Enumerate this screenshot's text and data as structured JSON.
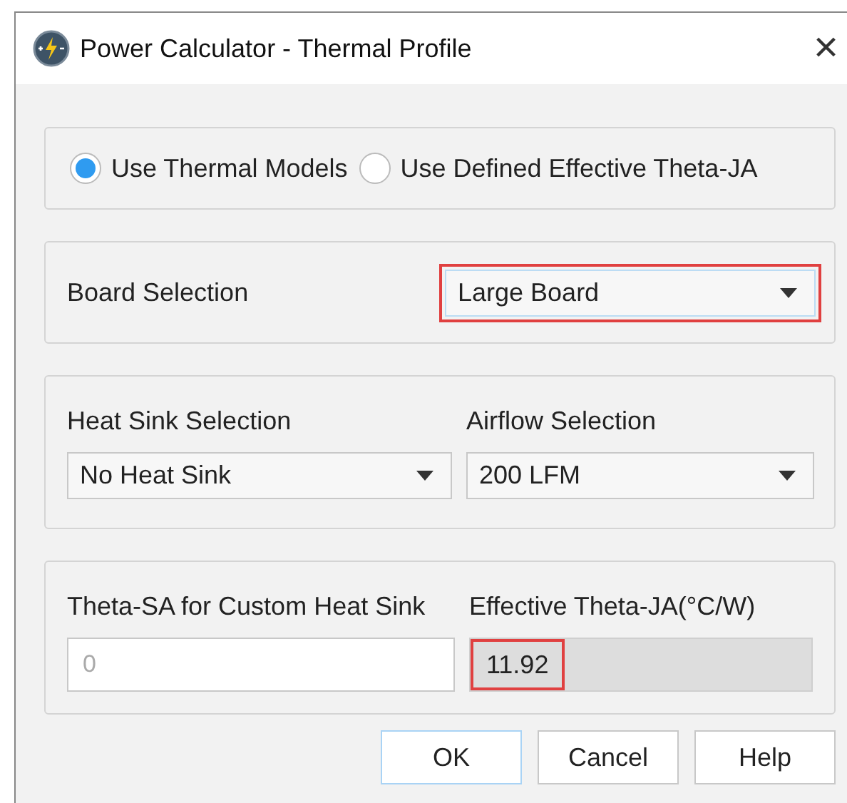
{
  "window": {
    "title": "Power Calculator - Thermal Profile",
    "close": "×"
  },
  "mode_options": [
    {
      "label": "Use Thermal Models",
      "selected": true
    },
    {
      "label": "Use Defined Effective Theta-JA",
      "selected": false
    }
  ],
  "board": {
    "label": "Board Selection",
    "value": "Large Board",
    "highlighted": true
  },
  "heat_sink": {
    "label": "Heat Sink Selection",
    "value": "No Heat Sink",
    "highlighted": false
  },
  "airflow": {
    "label": "Airflow Selection",
    "value": "200 LFM",
    "highlighted": false
  },
  "theta_sa": {
    "label": "Theta-SA for Custom Heat Sink",
    "value": "0",
    "disabled": true
  },
  "effective_theta_ja": {
    "label": "Effective Theta-JA(°C/W)",
    "value": "11.92",
    "highlighted": true
  },
  "buttons": [
    {
      "label": "OK",
      "default": true
    },
    {
      "label": "Cancel",
      "default": false
    },
    {
      "label": "Help",
      "default": false
    }
  ]
}
